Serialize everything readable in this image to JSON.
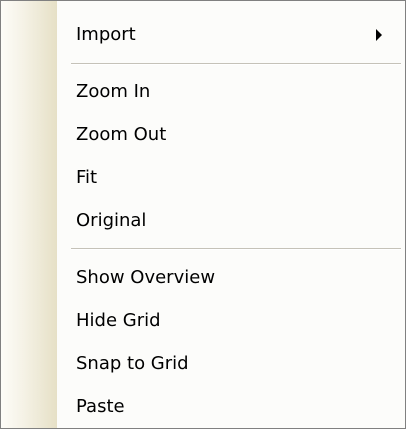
{
  "menu": {
    "items": [
      {
        "label": "Import",
        "submenu_icon": "submenu-arrow-icon"
      },
      {
        "label": "Zoom In"
      },
      {
        "label": "Zoom Out"
      },
      {
        "label": "Fit"
      },
      {
        "label": "Original"
      },
      {
        "label": "Show Overview"
      },
      {
        "label": "Hide Grid"
      },
      {
        "label": "Snap to Grid"
      },
      {
        "label": "Paste"
      }
    ]
  },
  "colors": {
    "menu_background": "#fcfcfa",
    "gutter": "#e6e0c6",
    "border": "#808080",
    "separator": "#c5c2b8",
    "text": "#000000"
  }
}
